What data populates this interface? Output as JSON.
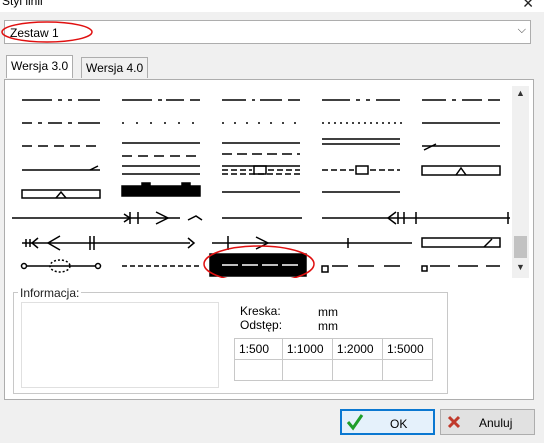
{
  "window": {
    "title": "Styl linii",
    "close_icon": "close-icon"
  },
  "preset": {
    "selected": "Zestaw 1"
  },
  "tabs": [
    {
      "label": "Wersja 3.0",
      "active": true
    },
    {
      "label": "Wersja 4.0",
      "active": false
    }
  ],
  "info": {
    "group_label": "Informacja:",
    "dash_label": "Kreska:",
    "dash_unit": "mm",
    "gap_label": "Odstęp:",
    "gap_unit": "mm",
    "scales": [
      "1:500",
      "1:1000",
      "1:2000",
      "1:5000"
    ]
  },
  "buttons": {
    "ok": "OK",
    "cancel": "Anuluj"
  },
  "colors": {
    "accent": "#0b78d1",
    "highlight_circle": "#e01010",
    "ok_check": "#1e9e2a",
    "cancel_x": "#c0392b"
  }
}
